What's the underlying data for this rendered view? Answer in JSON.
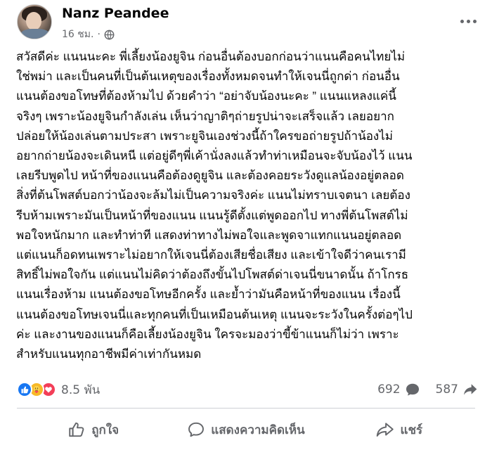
{
  "post": {
    "author": "Nanz Peandee",
    "time": "16 ชม.",
    "separator": "·",
    "body": "สวัสดีค่ะ แนนนะคะ พี่เลี้ยงน้องยูจิน ก่อนอื่นต้องบอกก่อนว่าแนนคือคนไทยไม่\nใช่พม่า และเป็นคนที่เป็นต้นเหตุของเรื่องทั้งหมดจนทำให้เจนนี่ถูกด่า ก่อนอื่น\nแนนต้องขอโทษที่ต้องห้ามไป ด้วยคำว่า “อย่าจับน้องนะคะ ” แนนแหลงแค่นี้\nจริงๆ เพราะน้องยูจินกำลังเล่น เห็นว่าญาติๆถ่ายรูปน่าจะเสร็จแล้ว เลยอยาก\nปล่อยให้น้องเล่นตามประสา เพราะยูจินเองช่วงนี้ถ้าใครขอถ่ายรูปถ้าน้องไม่\nอยากถ่ายน้องจะเดินหนี แต่อยู่ดีๆพี่เค้านั่งลงแล้วทำท่าเหมือนจะจับน้องไว้ แนน\nเลยรีบพูดไป หน้าที่ของแนนคือต้องดูยูจิน และต้องคอยระวังดูแลน้องอยู่ตลอด\nสิ่งที่ต้นโพสต์บอกว่าน้องจะล้มไม่เป็นความจริงค่ะ แนนไม่ทราบเจตนา เลยต้อง\nรีบห้ามเพราะมันเป็นหน้าที่ของแนน แนนรู้ดีตั้งแต่พูดออกไป ทางพี่ต้นโพสต์ไม่\nพอใจหนักมาก และทำท่าที แสดงท่าทางไม่พอใจและพูดจาแทกแนนอยู่ตลอด\nแต่แนนก็อดทนเพราะไม่อยากให้เจนนี่ต้องเสียชื่อเสียง และเข้าใจดีว่าคนเรามี\nสิทธิ์ไม่พอใจกัน แต่แนนไม่คิดว่าต้องถึงขั้นไปโพสต์ด่าเจนนี่ขนาดนั้น ถ้าโกรธ\nแนนเรื่องห้าม แนนต้องขอโทษอีกครั้ง และย้ำว่ามันคือหน้าที่ของแนน เรื่องนี้\nแนนต้องขอโทษเจนนี่และทุกคนที่เป็นเหมือนต้นเหตุ แนนจะระวังในครั้งต่อๆไป\nค่ะ และงานของแนนก็คือเลี้ยงน้องยูจิน ใครจะมองว่าขี้ข้าแนนก็ไม่ว่า เพราะ\nสำหรับแนนทุกอาชีพมีค่าเท่ากันหมด"
  },
  "stats": {
    "reactions": "8.5 พัน",
    "comments": "692",
    "shares": "587"
  },
  "actions": {
    "like": "ถูกใจ",
    "comment": "แสดงความคิดเห็น",
    "share": "แชร์"
  },
  "icons": {
    "privacy": "globe-icon",
    "more": "more-options-icon",
    "reaction_like": "like-reaction-icon",
    "reaction_care": "care-reaction-icon",
    "reaction_love": "love-reaction-icon",
    "comment_stat": "comment-bubble-icon",
    "share_stat": "share-arrow-icon"
  },
  "colors": {
    "like": "#1877f2",
    "care": "#f7b928",
    "love": "#f33e58",
    "secondary_text": "#65676b"
  }
}
